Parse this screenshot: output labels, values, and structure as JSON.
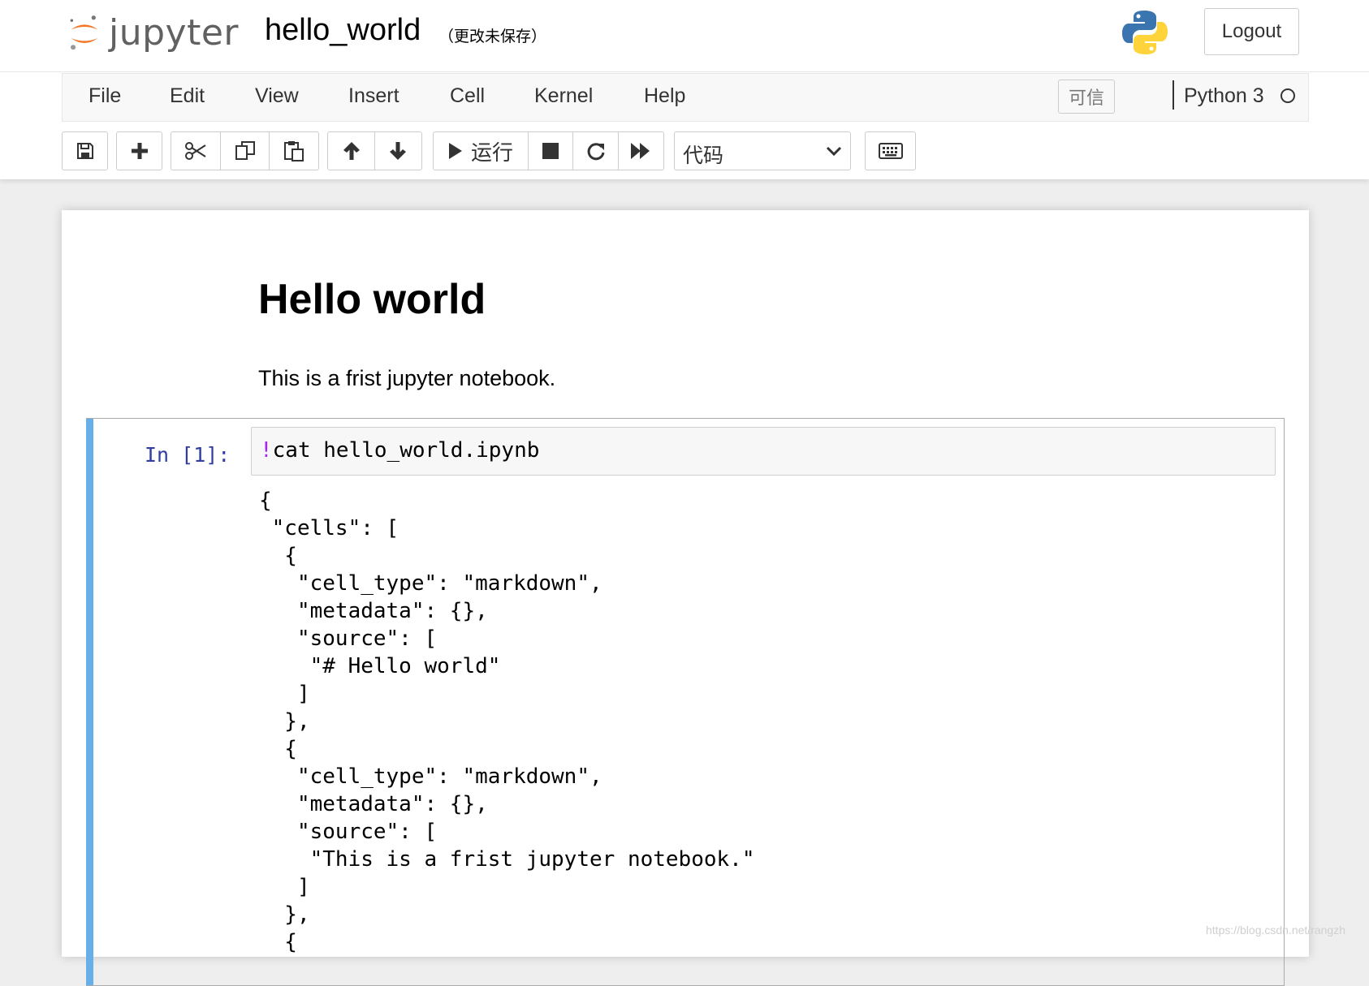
{
  "header": {
    "logo_text": "jupyter",
    "notebook_name": "hello_world",
    "save_status": "（更改未保存）",
    "logout_label": "Logout"
  },
  "menubar": {
    "items": [
      "File",
      "Edit",
      "View",
      "Insert",
      "Cell",
      "Kernel",
      "Help"
    ],
    "trusted_label": "可信",
    "kernel_name": "Python 3"
  },
  "toolbar": {
    "run_label": "运行",
    "cell_type": "代码"
  },
  "notebook": {
    "markdown_heading": "Hello world",
    "markdown_paragraph": "This is a frist jupyter notebook.",
    "code_cell": {
      "prompt": "In [1]:",
      "bang": "!",
      "input": "cat hello_world.ipynb",
      "output": "{\n \"cells\": [\n  {\n   \"cell_type\": \"markdown\",\n   \"metadata\": {},\n   \"source\": [\n    \"# Hello world\"\n   ]\n  },\n  {\n   \"cell_type\": \"markdown\",\n   \"metadata\": {},\n   \"source\": [\n    \"This is a frist jupyter notebook.\"\n   ]\n  },\n  {"
    }
  },
  "watermark": "https://blog.csdn.net/rangzh",
  "colors": {
    "cell_selected_bar": "#66afe9",
    "prompt": "#303f9f",
    "bang": "#aa22ff",
    "jupyter_orange": "#f37726"
  }
}
